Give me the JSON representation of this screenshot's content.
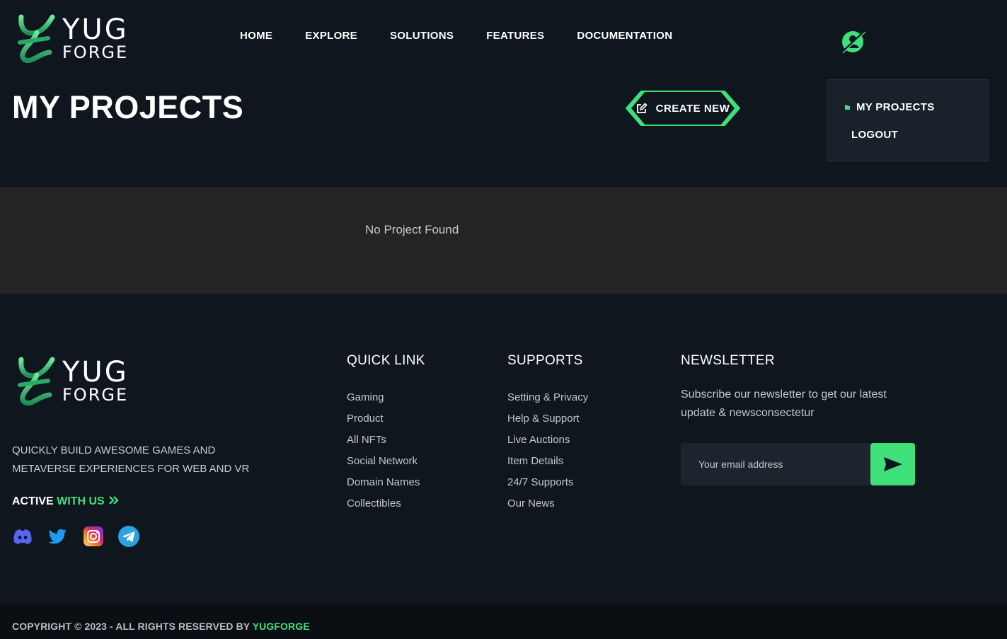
{
  "brand": {
    "logo_line1": "YUG",
    "logo_line2": "FORGE"
  },
  "nav": {
    "items": [
      "HOME",
      "EXPLORE",
      "SOLUTIONS",
      "FEATURES",
      "DOCUMENTATION"
    ]
  },
  "page": {
    "title": "MY PROJECTS",
    "create_label": "CREATE NEW",
    "empty_message": "No Project Found"
  },
  "user_menu": {
    "items": [
      "MY PROJECTS",
      "LOGOUT"
    ]
  },
  "footer": {
    "tagline": "QUICKLY BUILD AWESOME GAMES AND METAVERSE EXPERIENCES FOR WEB AND VR",
    "active_prefix": "ACTIVE",
    "active_highlight": "WITH US",
    "socials": [
      "discord-icon",
      "twitter-icon",
      "instagram-icon",
      "telegram-icon"
    ],
    "quick_link": {
      "title": "QUICK LINK",
      "items": [
        "Gaming",
        "Product",
        "All NFTs",
        "Social Network",
        "Domain Names",
        "Collectibles"
      ]
    },
    "supports": {
      "title": "SUPPORTS",
      "items": [
        "Setting & Privacy",
        "Help & Support",
        "Live Auctions",
        "Item Details",
        "24/7 Supports",
        "Our News"
      ]
    },
    "newsletter": {
      "title": "NEWSLETTER",
      "text": "Subscribe our newsletter to get our latest update & newsconsectetur",
      "placeholder": "Your email address"
    },
    "copyright": "COPYRIGHT © 2023 - ALL RIGHTS RESERVED BY",
    "copyright_brand": "YUGFORGE"
  },
  "colors": {
    "accent": "#3fe07a",
    "background": "#0f161e",
    "band": "#242424"
  }
}
